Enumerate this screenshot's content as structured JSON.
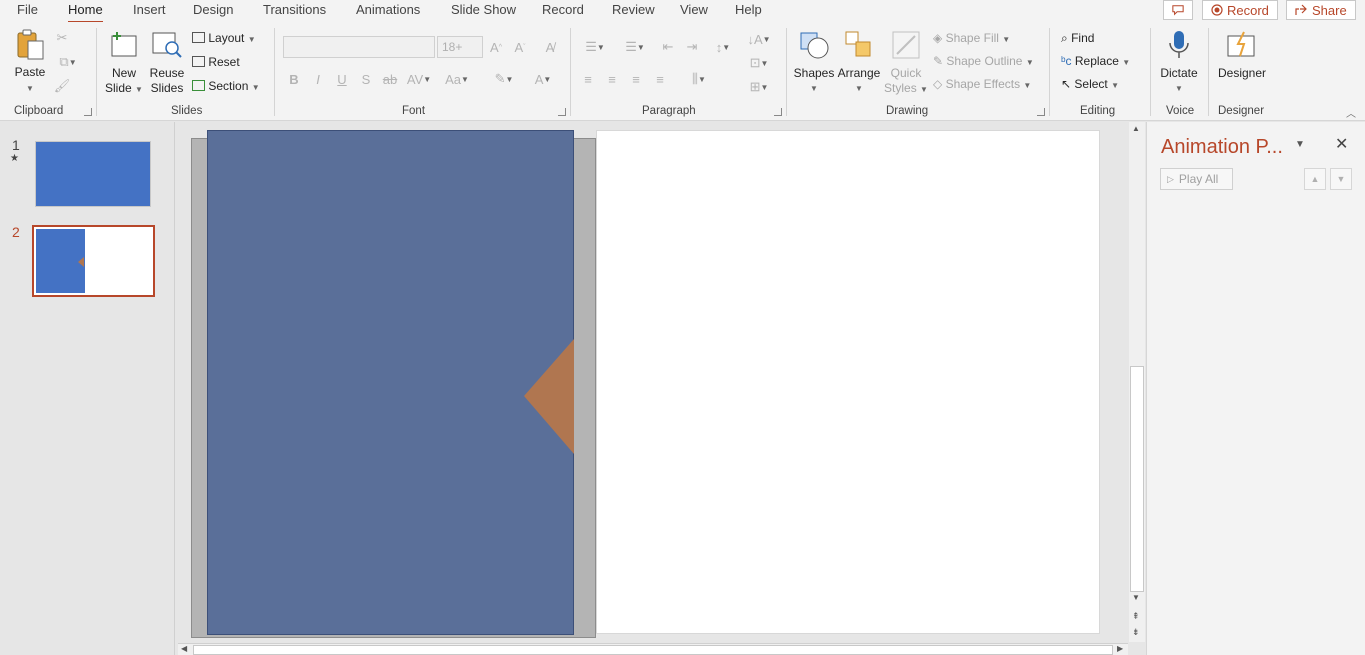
{
  "tabs": [
    "File",
    "Home",
    "Insert",
    "Design",
    "Transitions",
    "Animations",
    "Slide Show",
    "Record",
    "Review",
    "View",
    "Help"
  ],
  "active_tab": "Home",
  "top_right": {
    "comment_icon": "comment-icon",
    "record_label": "Record",
    "share_label": "Share"
  },
  "clipboard": {
    "paste": "Paste",
    "group": "Clipboard"
  },
  "slides_group": {
    "new_slide_1": "New",
    "new_slide_2": "Slide",
    "reuse_1": "Reuse",
    "reuse_2": "Slides",
    "layout": "Layout",
    "reset": "Reset",
    "section": "Section",
    "group": "Slides"
  },
  "font": {
    "font_name": "",
    "font_size": "18+",
    "group": "Font"
  },
  "paragraph": {
    "group": "Paragraph"
  },
  "drawing": {
    "shapes": "Shapes",
    "arrange": "Arrange",
    "quick_1": "Quick",
    "quick_2": "Styles",
    "shape_fill": "Shape Fill",
    "shape_outline": "Shape Outline",
    "shape_effects": "Shape Effects",
    "group": "Drawing"
  },
  "editing": {
    "find": "Find",
    "replace": "Replace",
    "select": "Select",
    "group": "Editing"
  },
  "voice": {
    "dictate": "Dictate",
    "group": "Voice"
  },
  "designer": {
    "designer": "Designer",
    "group": "Designer"
  },
  "thumbnails": [
    {
      "number": "1",
      "marker": "★"
    },
    {
      "number": "2",
      "marker": ""
    }
  ],
  "animation_pane": {
    "title": "Animation P...",
    "play_all": "Play All"
  },
  "colors": {
    "accent": "#b7472a",
    "slide_blue": "#4472c4",
    "panel_blue": "#5a6f99",
    "shape_orange": "#b07650"
  }
}
